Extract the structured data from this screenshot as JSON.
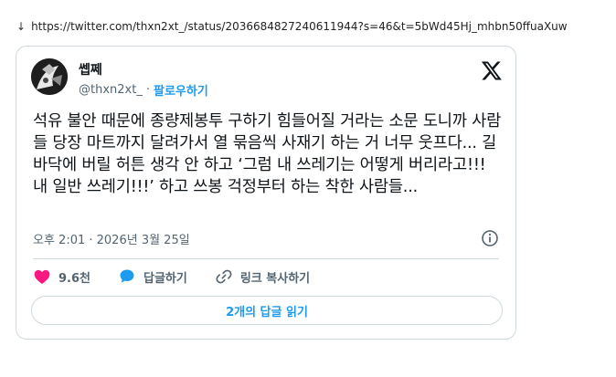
{
  "page": {
    "arrow": "↓",
    "url": "https://twitter.com/thxn2xt_/status/2036684827240611944?s=46&t=5bWd45Hj_mhbn50ffuaXuw"
  },
  "tweet": {
    "display_name": "쎕쩨",
    "handle": "@thxn2xt_",
    "separator": "·",
    "follow_label": "팔로우하기",
    "text": "석유 불안 때문에 종량제봉투 구하기 힘들어질 거라는 소문 도니까 사람들 당장 마트까지 달려가서 열 묶음씩 사재기 하는 거 너무 웃프다... 길바닥에 버릴 허튼 생각 안 하고 ‘그럼 내 쓰레기는 어떻게 버리라고!!! 내 일반 쓰레기!!!’ 하고 쓰봉 걱정부터 하는 착한 사람들...",
    "timestamp": "오후 2:01 · 2026년 3월 25일",
    "likes_count": "9.6천",
    "reply_label": "답글하기",
    "copy_link_label": "링크 복사하기",
    "read_replies_label": "2개의 답글 읽기"
  },
  "colors": {
    "accent": "#1d9bf0",
    "heart": "#f91880",
    "muted_text": "#536471",
    "border": "#cfd9de"
  },
  "icons": [
    "download-arrow-icon",
    "avatar",
    "x-logo-icon",
    "info-icon",
    "heart-icon",
    "reply-bubble-icon",
    "link-icon"
  ]
}
